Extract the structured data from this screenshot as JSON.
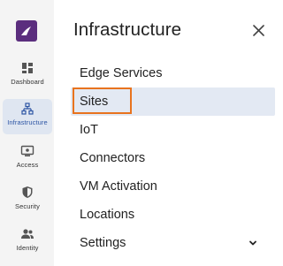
{
  "rail": {
    "logo_icon": "brand-logo-icon",
    "items": [
      {
        "label": "Dashboard",
        "icon": "dashboard-icon",
        "active": false
      },
      {
        "label": "Infrastructure",
        "icon": "network-icon",
        "active": true
      },
      {
        "label": "Access",
        "icon": "access-icon",
        "active": false
      },
      {
        "label": "Security",
        "icon": "shield-icon",
        "active": false
      },
      {
        "label": "Identity",
        "icon": "users-icon",
        "active": false
      }
    ]
  },
  "panel": {
    "title": "Infrastructure",
    "close_icon": "close-icon",
    "items": [
      {
        "label": "Edge Services"
      },
      {
        "label": "Sites",
        "active": true,
        "highlighted": true
      },
      {
        "label": "IoT"
      },
      {
        "label": "Connectors"
      },
      {
        "label": "VM Activation"
      },
      {
        "label": "Locations"
      },
      {
        "label": "Settings",
        "expandable": true
      }
    ]
  },
  "colors": {
    "brand": "#5b2e7e",
    "active_bg": "#e3e9f3",
    "highlight_border": "#e8731e",
    "rail_bg": "#f4f4f4"
  }
}
